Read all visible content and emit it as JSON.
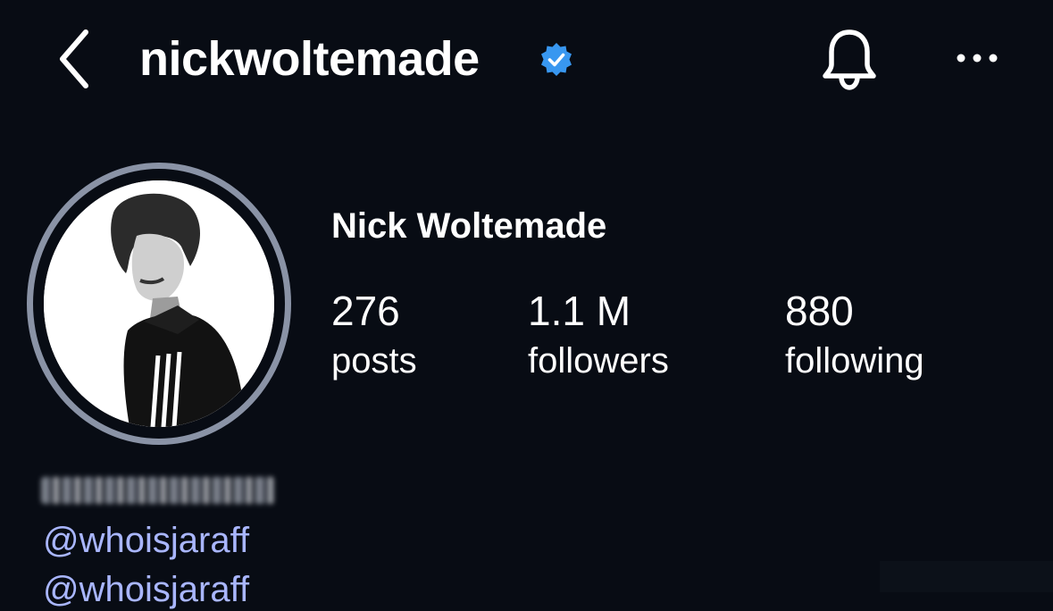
{
  "header": {
    "username": "nickwoltemade",
    "verified": true,
    "icons": [
      "back-arrow-icon",
      "verified-badge-icon",
      "bell-icon",
      "more-options-icon"
    ]
  },
  "profile": {
    "display_name": "Nick Woltemade",
    "avatar_ring_color": "#8a93a6"
  },
  "stats": {
    "posts": {
      "value": "276",
      "label": "posts"
    },
    "followers": {
      "value": "1.1 M",
      "label": "followers"
    },
    "following": {
      "value": "880",
      "label": "following"
    }
  },
  "bio": {
    "links": [
      "@whoisjaraff",
      "@whoisjaraff"
    ]
  },
  "colors": {
    "background": "#080c14",
    "link": "#a9b6ff",
    "verified": "#3897f0"
  }
}
